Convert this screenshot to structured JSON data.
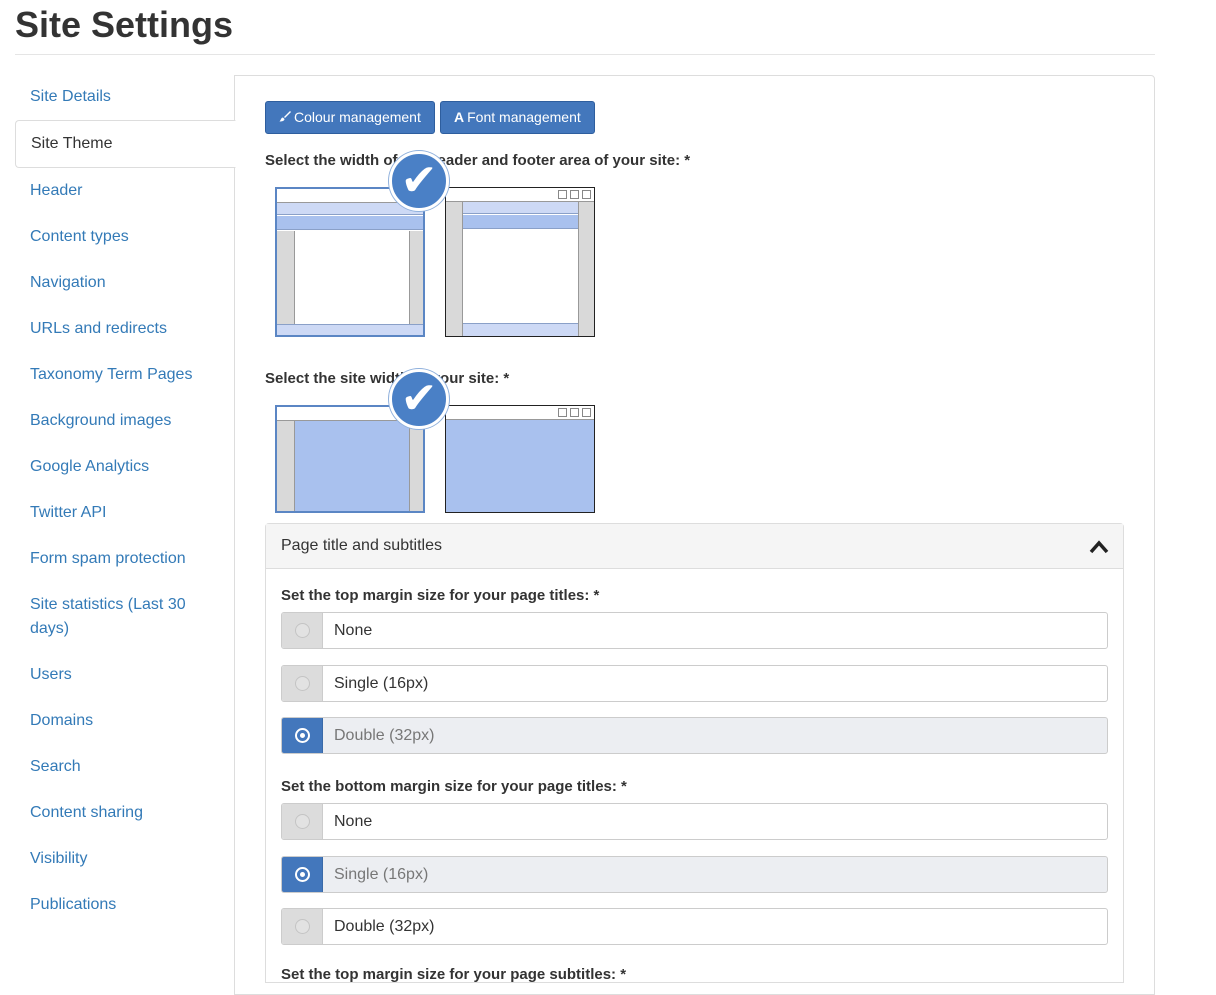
{
  "page": {
    "title": "Site Settings"
  },
  "sidebar": {
    "items": [
      {
        "label": "Site Details"
      },
      {
        "label": "Site Theme",
        "active": true
      },
      {
        "label": "Header"
      },
      {
        "label": "Content types"
      },
      {
        "label": "Navigation"
      },
      {
        "label": "URLs and redirects"
      },
      {
        "label": "Taxonomy Term Pages"
      },
      {
        "label": "Background images"
      },
      {
        "label": "Google Analytics"
      },
      {
        "label": "Twitter API"
      },
      {
        "label": "Form spam protection"
      },
      {
        "label": "Site statistics (Last 30 days)"
      },
      {
        "label": "Users"
      },
      {
        "label": "Domains"
      },
      {
        "label": "Search"
      },
      {
        "label": "Content sharing"
      },
      {
        "label": "Visibility"
      },
      {
        "label": "Publications"
      }
    ]
  },
  "toolbar": {
    "colour_label": "Colour management",
    "font_label": "Font management",
    "colour_icon": "paintbrush-icon",
    "font_icon": "font-icon"
  },
  "header_width": {
    "label": "Select the width of the header and footer area of your site: *",
    "selected_index": 0
  },
  "site_width": {
    "label": "Select the site width of your site: *",
    "selected_index": 0
  },
  "accordion": {
    "title": "Page title and subtitles",
    "expanded": true
  },
  "top_margin": {
    "label": "Set the top margin size for your page titles: *",
    "options": [
      "None",
      "Single (16px)",
      "Double (32px)"
    ],
    "selected": "Double (32px)"
  },
  "bottom_margin": {
    "label": "Set the bottom margin size for your page titles: *",
    "options": [
      "None",
      "Single (16px)",
      "Double (32px)"
    ],
    "selected": "Single (16px)"
  },
  "subtitle_top_margin": {
    "label": "Set the top margin size for your page subtitles: *"
  },
  "colors": {
    "primary": "#4377bc",
    "link": "#337ab7",
    "preview_fill": "#a9c1ee",
    "preview_band": "#cdd9f5"
  }
}
